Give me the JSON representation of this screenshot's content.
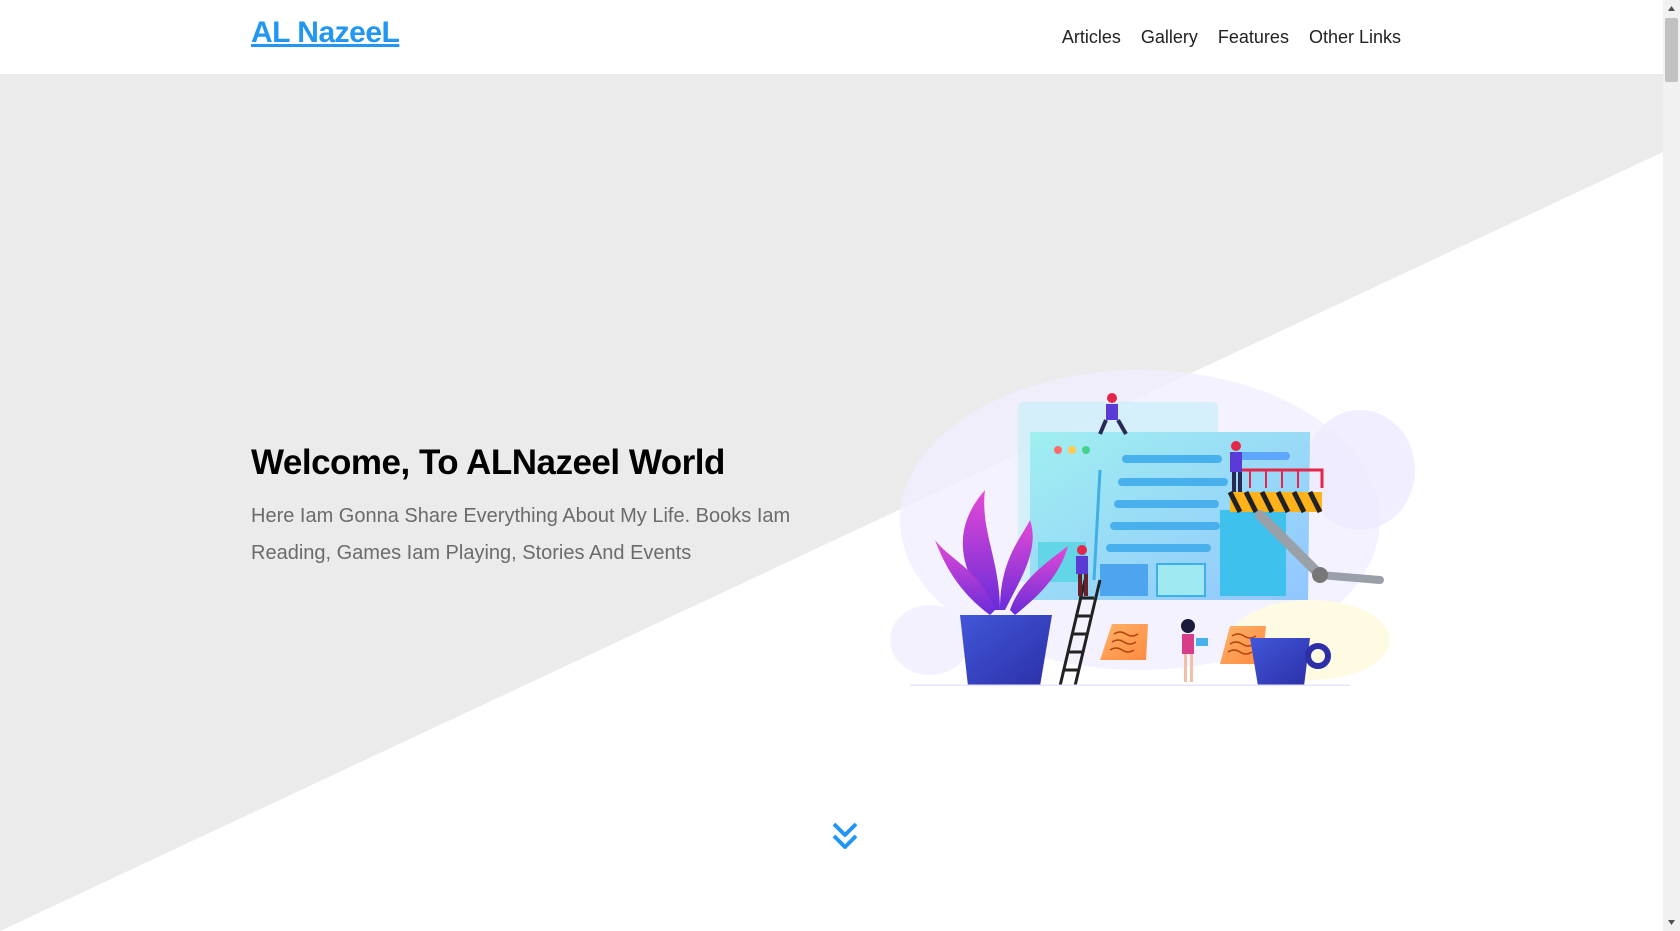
{
  "header": {
    "logo": "AL NazeeL",
    "nav": [
      "Articles",
      "Gallery",
      "Features",
      "Other Links"
    ]
  },
  "hero": {
    "title": "Welcome, To ALNazeel World",
    "text": "Here Iam Gonna Share Everything About My Life. Books Iam Reading, Games Iam Playing, Stories And Events",
    "scroll_icon": "double-chevron-down-icon"
  },
  "colors": {
    "accent": "#2196f3",
    "hero_bg": "#ebebeb",
    "text_muted": "#6b6b6b",
    "heading": "#000000"
  }
}
